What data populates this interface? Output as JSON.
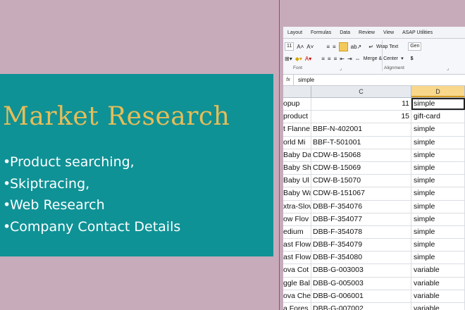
{
  "banner": {
    "title": "Market Research",
    "bullets": [
      "Product searching,",
      "Skiptracing,",
      "Web Research",
      "Company Contact Details"
    ]
  },
  "spreadsheet": {
    "ribbon_tabs": [
      "Layout",
      "Formulas",
      "Data",
      "Review",
      "View",
      "ASAP Utilities"
    ],
    "font_size": "11",
    "wrap_text": "Wrap Text",
    "merge_center": "Merge & Center",
    "number_format_partial": "Gen",
    "currency_symbol": "$",
    "groups": {
      "font": "Font",
      "alignment": "Alignment"
    },
    "formula_label": "fx",
    "formula_value": "simple",
    "columns": [
      "C",
      "D"
    ],
    "rows": [
      {
        "b": "opup",
        "c": "11",
        "d": "simple"
      },
      {
        "b": "product",
        "c": "15",
        "d": "gift-card"
      },
      {
        "b": "t Flanne",
        "c": "BBF-N-402001",
        "d": "simple"
      },
      {
        "b": "orld Mi",
        "c": "BBF-T-501001",
        "d": "simple"
      },
      {
        "b": "Baby Da",
        "c": "CDW-B-15068",
        "d": "simple"
      },
      {
        "b": "Baby Sh",
        "c": "CDW-B-15069",
        "d": "simple"
      },
      {
        "b": "Baby Ul",
        "c": "CDW-B-15070",
        "d": "simple"
      },
      {
        "b": "Baby Wa",
        "c": "CDW-B-151067",
        "d": "simple"
      },
      {
        "b": "xtra-Slov",
        "c": "DBB-F-354076",
        "d": "simple"
      },
      {
        "b": "ow Flov",
        "c": "DBB-F-354077",
        "d": "simple"
      },
      {
        "b": "edium",
        "c": "DBB-F-354078",
        "d": "simple"
      },
      {
        "b": "ast Flow",
        "c": "DBB-F-354079",
        "d": "simple"
      },
      {
        "b": "ast Flow",
        "c": "DBB-F-354080",
        "d": "simple"
      },
      {
        "b": "ova Cot",
        "c": "DBB-G-003003",
        "d": "variable"
      },
      {
        "b": "ggle Bal",
        "c": "DBB-G-005003",
        "d": "variable"
      },
      {
        "b": "ova Che",
        "c": "DBB-G-006001",
        "d": "variable"
      },
      {
        "b": "a Fores",
        "c": "DBB-G-007002",
        "d": "variable"
      }
    ]
  }
}
